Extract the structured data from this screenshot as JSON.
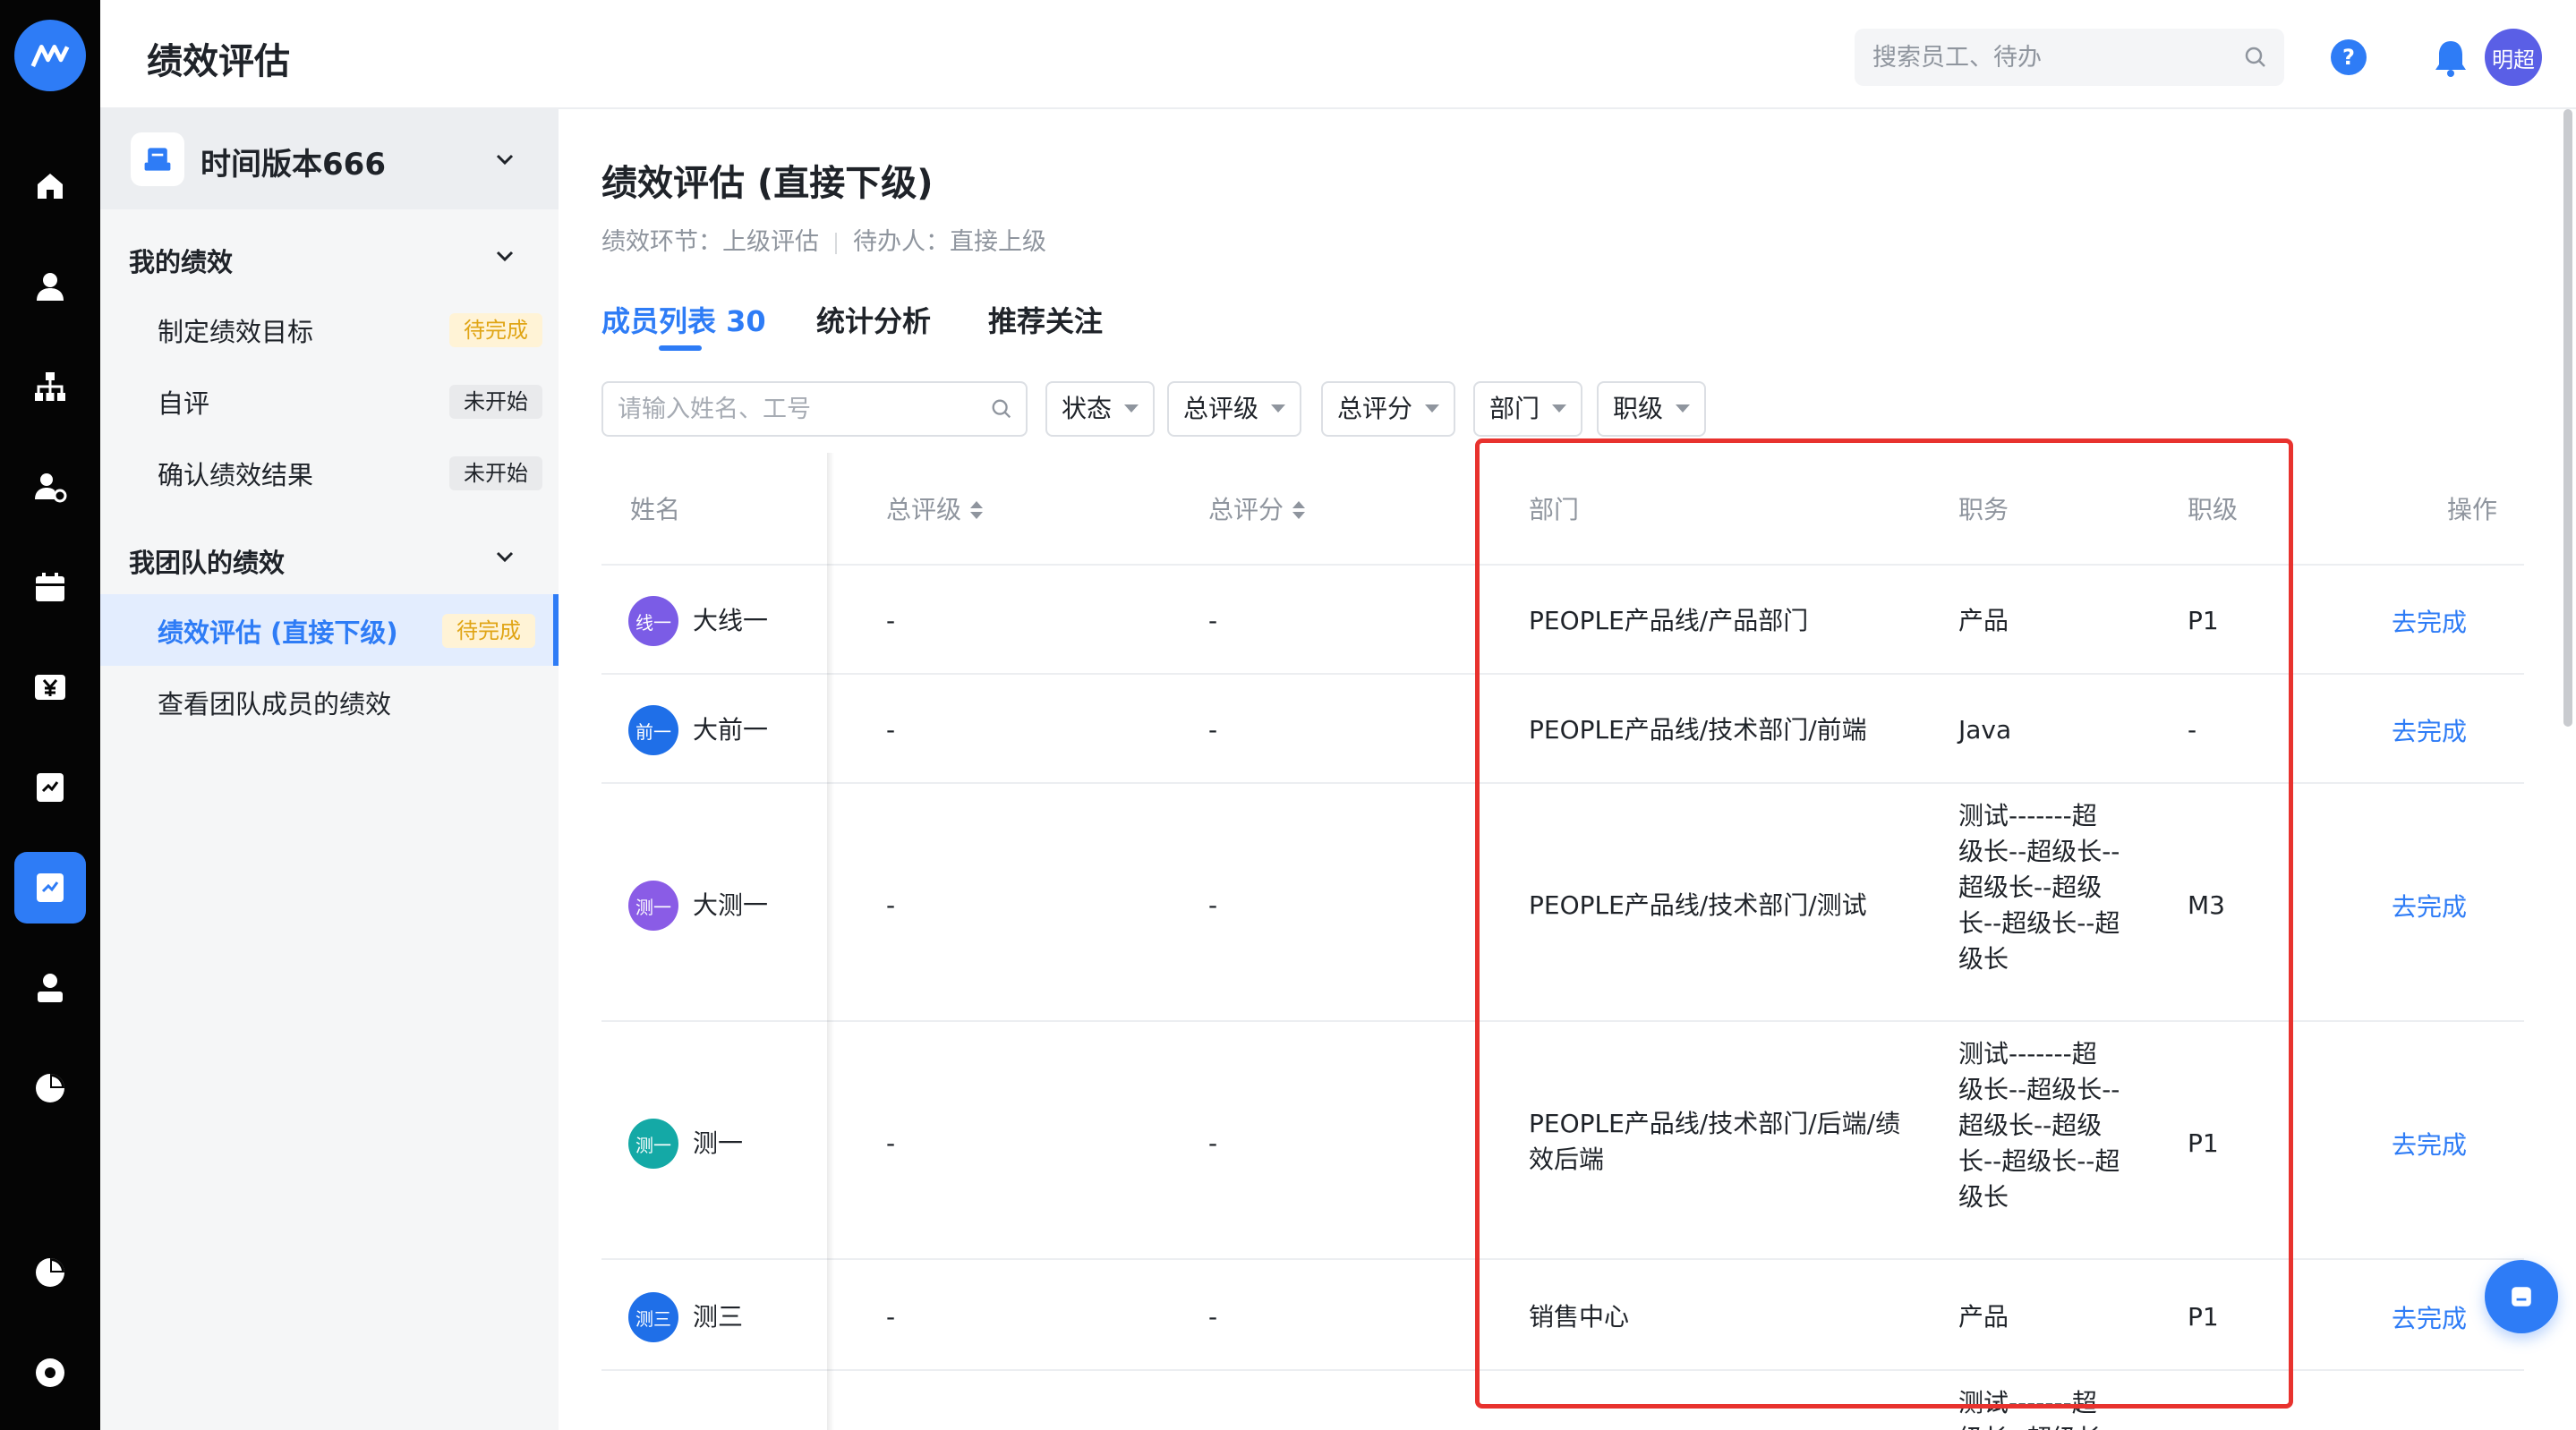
{
  "header": {
    "app_title": "绩效评估",
    "search_placeholder": "搜索员工、待办",
    "help_label": "?",
    "user_avatar": "明超"
  },
  "rail": {
    "icons": [
      "logo-icon",
      "home-icon",
      "user-icon",
      "org-chart-icon",
      "user-settings-icon",
      "calendar-icon",
      "salary-icon",
      "performance-icon",
      "performance-active-icon",
      "profile-icon",
      "pie-chart-icon",
      "report-icon",
      "settings-icon"
    ]
  },
  "sidebar": {
    "version_name": "时间版本666",
    "group1": {
      "title": "我的绩效",
      "items": [
        {
          "label": "制定绩效目标",
          "badge": "待完成"
        },
        {
          "label": "自评",
          "badge": "未开始"
        },
        {
          "label": "确认绩效结果",
          "badge": "未开始"
        }
      ]
    },
    "group2": {
      "title": "我团队的绩效",
      "items": [
        {
          "label": "绩效评估 (直接下级)",
          "badge": "待完成"
        },
        {
          "label": "查看团队成员的绩效",
          "badge": ""
        }
      ]
    }
  },
  "main": {
    "title": "绩效评估 (直接下级)",
    "meta_stage": "绩效环节：上级评估",
    "meta_assignee": "待办人：直接上级",
    "tabs": [
      {
        "label": "成员列表 30"
      },
      {
        "label": "统计分析"
      },
      {
        "label": "推荐关注"
      }
    ],
    "filter_placeholder": "请输入姓名、工号",
    "filters": [
      "状态",
      "总评级",
      "总评分",
      "部门",
      "职级"
    ]
  },
  "table": {
    "headers": {
      "name": "姓名",
      "rating": "总评级",
      "score": "总评分",
      "dept": "部门",
      "position": "职务",
      "level": "职级",
      "action": "操作"
    },
    "rows": [
      {
        "avatar": "线一",
        "avatar_color": "#7b5ce6",
        "name": "大线一",
        "rating": "-",
        "score": "-",
        "dept": "PEOPLE产品线/产品部门",
        "position": "产品",
        "level": "P1",
        "action": "去完成"
      },
      {
        "avatar": "前一",
        "avatar_color": "#1f6fe8",
        "name": "大前一",
        "rating": "-",
        "score": "-",
        "dept": "PEOPLE产品线/技术部门/前端",
        "position": "Java",
        "level": "-",
        "action": "去完成"
      },
      {
        "avatar": "测一",
        "avatar_color": "#8a5ce6",
        "name": "大测一",
        "rating": "-",
        "score": "-",
        "dept": "PEOPLE产品线/技术部门/测试",
        "position": "测试-------超\n级长--超级长--\n超级长--超级\n长--超级长--超\n级长",
        "level": "M3",
        "action": "去完成"
      },
      {
        "avatar": "测一",
        "avatar_color": "#14a9a6",
        "name": "测一",
        "rating": "-",
        "score": "-",
        "dept": "PEOPLE产品线/技术部门/后端/绩\n效后端",
        "position": "测试-------超\n级长--超级长--\n超级长--超级\n长--超级长--超\n级长",
        "level": "P1",
        "action": "去完成"
      },
      {
        "avatar": "测三",
        "avatar_color": "#1f6fe8",
        "name": "测三",
        "rating": "-",
        "score": "-",
        "dept": "销售中心",
        "position": "产品",
        "level": "P1",
        "action": "去完成"
      },
      {
        "avatar": "",
        "avatar_color": "#ffffff",
        "name": "",
        "rating": "",
        "score": "",
        "dept": "",
        "position": "测试-------超\n级长--超级长--",
        "level": "",
        "action": ""
      }
    ]
  },
  "colors": {
    "accent": "#2e7cf6",
    "highlight": "#e8322e",
    "pending": "#e0a516"
  }
}
